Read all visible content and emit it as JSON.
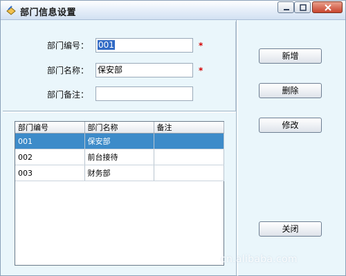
{
  "window": {
    "title": "部门信息设置"
  },
  "form": {
    "dept_no_label": "部门编号：",
    "dept_no_value": "001",
    "dept_name_label": "部门名称：",
    "dept_name_value": "保安部",
    "dept_note_label": "部门备注：",
    "dept_note_value": "",
    "required_mark": "*"
  },
  "grid": {
    "columns": [
      "部门编号",
      "部门名称",
      "备注"
    ],
    "rows": [
      {
        "no": "001",
        "name": "保安部",
        "note": "",
        "selected": true
      },
      {
        "no": "002",
        "name": "前台接待",
        "note": "",
        "selected": false
      },
      {
        "no": "003",
        "name": "财务部",
        "note": "",
        "selected": false
      }
    ]
  },
  "buttons": {
    "add": "新增",
    "delete": "删除",
    "edit": "修改",
    "close": "关闭"
  },
  "watermark": "cn.alibaba.com",
  "colors": {
    "selection_row": "#3d8bc9",
    "required_star": "#d40000",
    "window_bg": "#eaf6fb"
  }
}
